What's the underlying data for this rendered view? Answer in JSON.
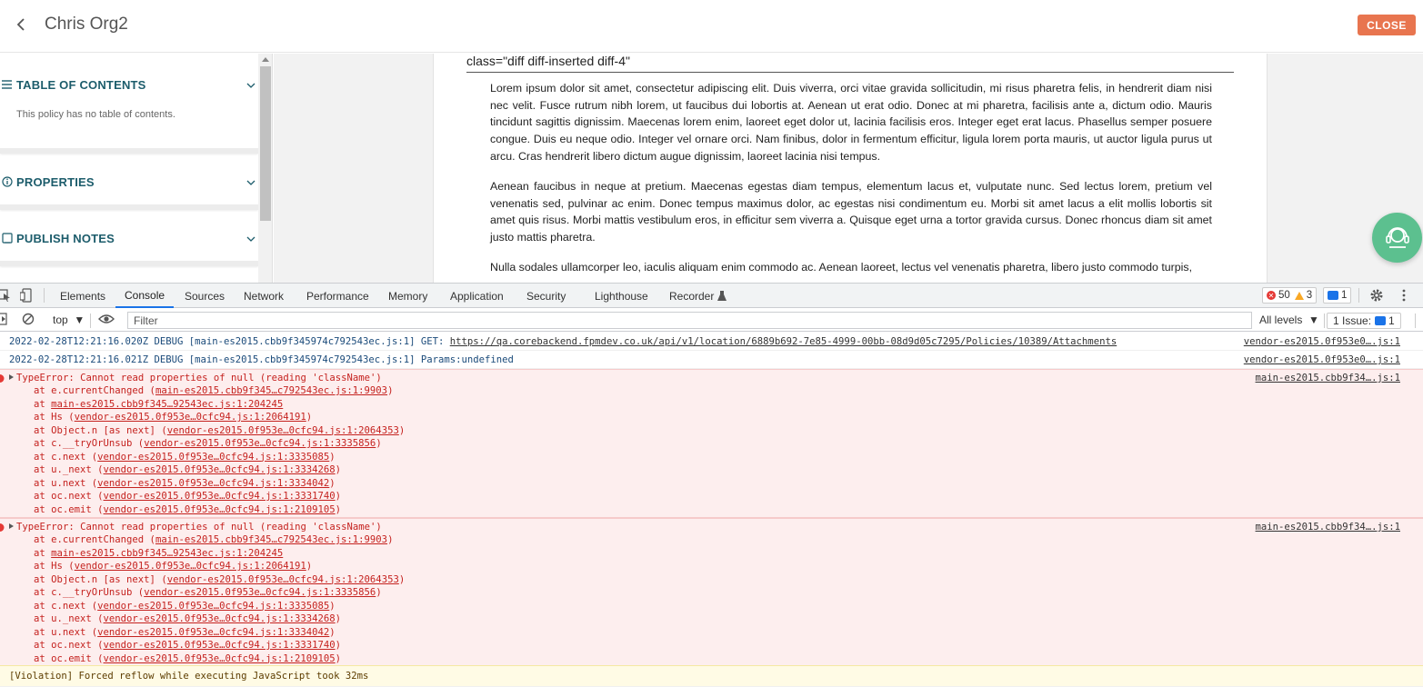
{
  "header": {
    "title": "Chris Org2",
    "close_label": "CLOSE"
  },
  "sidebar": {
    "sections": [
      {
        "label": "TABLE OF CONTENTS",
        "icon": "list-icon"
      },
      {
        "label": "PROPERTIES",
        "icon": "info-icon"
      },
      {
        "label": "PUBLISH NOTES",
        "icon": "notes-icon"
      }
    ],
    "toc_empty": "This policy has no table of contents."
  },
  "document": {
    "class_line": "class=\"diff diff-inserted diff-4\"",
    "paragraphs": [
      "Lorem ipsum dolor sit amet, consectetur adipiscing elit. Duis viverra, orci vitae gravida sollicitudin, mi risus pharetra felis, in hendrerit diam nisi nec velit. Fusce rutrum nibh lorem, ut faucibus dui lobortis at. Aenean ut erat odio. Donec at mi pharetra, facilisis ante a, dictum odio. Mauris tincidunt sagittis dignissim. Maecenas lorem enim, laoreet eget dolor ut, lacinia facilisis eros. Integer eget erat lacus. Phasellus semper posuere congue. Duis eu neque odio. Integer vel ornare orci. Nam finibus, dolor in fermentum efficitur, ligula lorem porta mauris, ut auctor ligula purus ut arcu. Cras hendrerit libero dictum augue dignissim, laoreet lacinia nisi tempus.",
      "Aenean faucibus in neque at pretium. Maecenas egestas diam tempus, elementum lacus et, vulputate nunc. Sed lectus lorem, pretium vel venenatis sed, pulvinar ac enim. Donec tempus maximus dolor, ac egestas nisi condimentum eu. Morbi sit amet lacus a elit mollis lobortis sit amet quis risus. Morbi mattis vestibulum eros, in efficitur sem viverra a. Quisque eget urna a tortor gravida cursus. Donec rhoncus diam sit amet justo mattis pharetra.",
      "Nulla sodales ullamcorper leo, iaculis aliquam enim commodo ac. Aenean laoreet, lectus vel venenatis pharetra, libero justo commodo turpis,"
    ]
  },
  "devtools": {
    "tabs": [
      "Elements",
      "Console",
      "Sources",
      "Network",
      "Performance",
      "Memory",
      "Application",
      "Security",
      "Lighthouse",
      "Recorder"
    ],
    "active_tab": "Console",
    "error_count": "50",
    "warning_count": "3",
    "message_count": "1",
    "context": "top",
    "filter_placeholder": "Filter",
    "levels": "All levels",
    "issues_label": "1 Issue:",
    "issues_count": "1",
    "console": {
      "debug_rows": [
        {
          "prefix": "2022-02-28T12:21:16.020Z DEBUG [main-es2015.cbb9f345974c792543ec.js:1] GET: ",
          "url": "https://qa.corebackend.fpmdev.co.uk/api/v1/location/6889b692-7e85-4999-00bb-08d9d05c7295/Policies/10389/Attachments",
          "source": "vendor-es2015.0f953e0….js:1"
        },
        {
          "prefix": "2022-02-28T12:21:16.021Z DEBUG [main-es2015.cbb9f345974c792543ec.js:1] Params:undefined",
          "url": "",
          "source": "vendor-es2015.0f953e0….js:1"
        }
      ],
      "errors": [
        {
          "message": "TypeError: Cannot read properties of null (reading 'className')",
          "source": "main-es2015.cbb9f34….js:1",
          "stack": [
            {
              "fn": "at e.currentChanged (",
              "loc": "main-es2015.cbb9f345…c792543ec.js:1:9903",
              "end": ")"
            },
            {
              "fn": "at ",
              "loc": "main-es2015.cbb9f345…92543ec.js:1:204245",
              "end": ""
            },
            {
              "fn": "at Hs (",
              "loc": "vendor-es2015.0f953e…0cfc94.js:1:2064191",
              "end": ")"
            },
            {
              "fn": "at Object.n [as next] (",
              "loc": "vendor-es2015.0f953e…0cfc94.js:1:2064353",
              "end": ")"
            },
            {
              "fn": "at c.__tryOrUnsub (",
              "loc": "vendor-es2015.0f953e…0cfc94.js:1:3335856",
              "end": ")"
            },
            {
              "fn": "at c.next (",
              "loc": "vendor-es2015.0f953e…0cfc94.js:1:3335085",
              "end": ")"
            },
            {
              "fn": "at u._next (",
              "loc": "vendor-es2015.0f953e…0cfc94.js:1:3334268",
              "end": ")"
            },
            {
              "fn": "at u.next (",
              "loc": "vendor-es2015.0f953e…0cfc94.js:1:3334042",
              "end": ")"
            },
            {
              "fn": "at oc.next (",
              "loc": "vendor-es2015.0f953e…0cfc94.js:1:3331740",
              "end": ")"
            },
            {
              "fn": "at oc.emit (",
              "loc": "vendor-es2015.0f953e…0cfc94.js:1:2109105",
              "end": ")"
            }
          ]
        },
        {
          "message": "TypeError: Cannot read properties of null (reading 'className')",
          "source": "main-es2015.cbb9f34….js:1",
          "stack": [
            {
              "fn": "at e.currentChanged (",
              "loc": "main-es2015.cbb9f345…c792543ec.js:1:9903",
              "end": ")"
            },
            {
              "fn": "at ",
              "loc": "main-es2015.cbb9f345…92543ec.js:1:204245",
              "end": ""
            },
            {
              "fn": "at Hs (",
              "loc": "vendor-es2015.0f953e…0cfc94.js:1:2064191",
              "end": ")"
            },
            {
              "fn": "at Object.n [as next] (",
              "loc": "vendor-es2015.0f953e…0cfc94.js:1:2064353",
              "end": ")"
            },
            {
              "fn": "at c.__tryOrUnsub (",
              "loc": "vendor-es2015.0f953e…0cfc94.js:1:3335856",
              "end": ")"
            },
            {
              "fn": "at c.next (",
              "loc": "vendor-es2015.0f953e…0cfc94.js:1:3335085",
              "end": ")"
            },
            {
              "fn": "at u._next (",
              "loc": "vendor-es2015.0f953e…0cfc94.js:1:3334268",
              "end": ")"
            },
            {
              "fn": "at u.next (",
              "loc": "vendor-es2015.0f953e…0cfc94.js:1:3334042",
              "end": ")"
            },
            {
              "fn": "at oc.next (",
              "loc": "vendor-es2015.0f953e…0cfc94.js:1:3331740",
              "end": ")"
            },
            {
              "fn": "at oc.emit (",
              "loc": "vendor-es2015.0f953e…0cfc94.js:1:2109105",
              "end": ")"
            }
          ]
        }
      ],
      "violation": "[Violation] Forced reflow while executing JavaScript took 32ms"
    }
  },
  "colors": {
    "accent_close": "#e8754f",
    "sidebar_heading": "#1c5c6b",
    "chat_fab": "#5cc08f",
    "console_error": "#c5221f",
    "devtools_active": "#1a73e8"
  }
}
